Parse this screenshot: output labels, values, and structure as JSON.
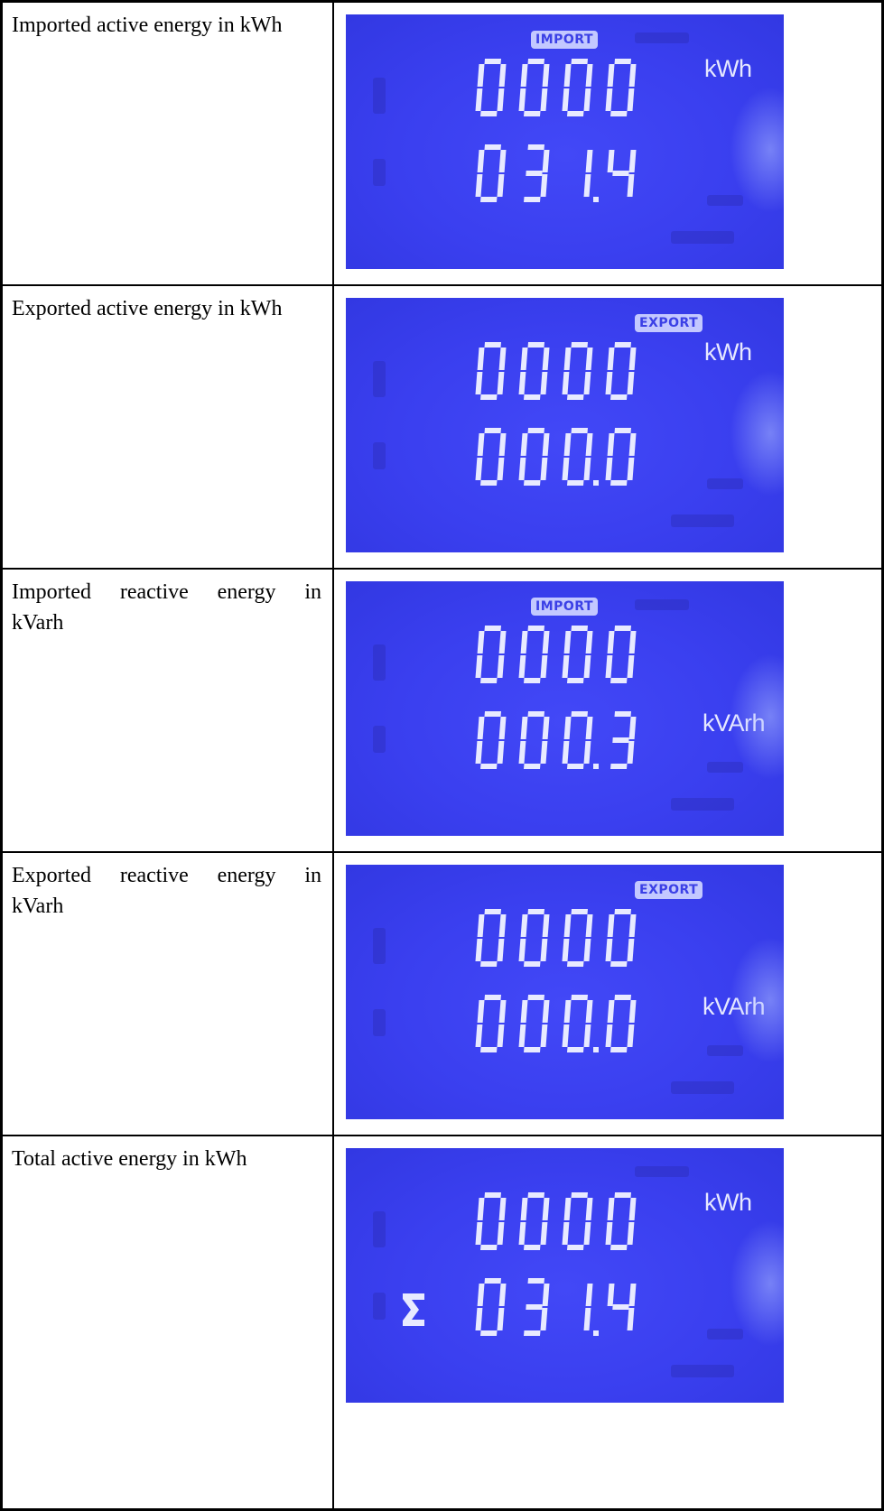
{
  "rows": [
    {
      "description": "Imported active energy in kWh",
      "badge": "IMPORT",
      "badge_type": "import",
      "line1": "0000",
      "line2": "031.4",
      "unit": "kWh",
      "unit_row": 1,
      "sigma": false
    },
    {
      "description": "Exported active energy in kWh",
      "badge": "EXPORT",
      "badge_type": "export",
      "line1": "0000",
      "line2": "000.0",
      "unit": "kWh",
      "unit_row": 1,
      "sigma": false
    },
    {
      "description": "Imported reactive energy in kVarh",
      "badge": "IMPORT",
      "badge_type": "import",
      "line1": "0000",
      "line2": "000.3",
      "unit": "kVArh",
      "unit_row": 2,
      "sigma": false
    },
    {
      "description": "Exported reactive energy in kVarh",
      "badge": "EXPORT",
      "badge_type": "export",
      "line1": "0000",
      "line2": "000.0",
      "unit": "kVArh",
      "unit_row": 2,
      "sigma": false
    },
    {
      "description": "Total active energy in kWh",
      "badge": "",
      "badge_type": "none",
      "line1": "0000",
      "line2": "031.4",
      "unit": "kWh",
      "unit_row": 1,
      "sigma": true
    }
  ],
  "colors": {
    "lcd_background": "#3a3fef",
    "segment": "#e8eaff",
    "badge_background": "#c3c8ff"
  }
}
